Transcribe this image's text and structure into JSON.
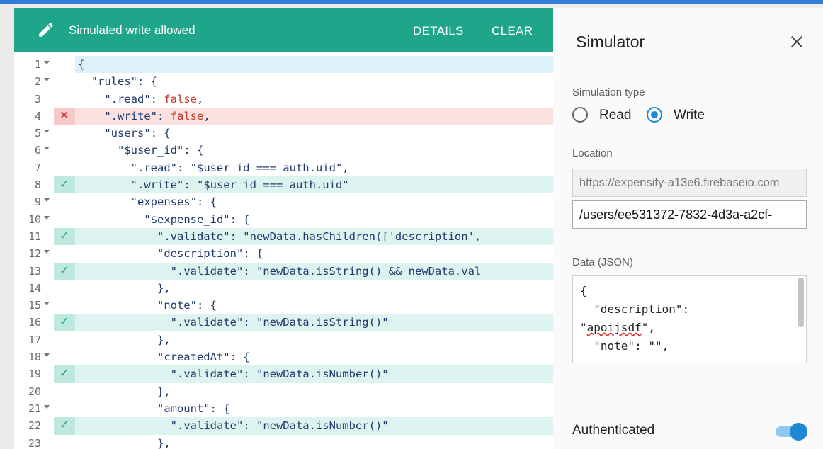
{
  "banner": {
    "message": "Simulated write allowed",
    "details_label": "DETAILS",
    "clear_label": "CLEAR",
    "icon": "pencil-icon"
  },
  "code_lines": [
    {
      "num": "1",
      "fold": true,
      "mark": "",
      "state": "sel",
      "text": "{"
    },
    {
      "num": "2",
      "fold": true,
      "mark": "",
      "state": "",
      "text": "  \"rules\": {"
    },
    {
      "num": "3",
      "fold": false,
      "mark": "",
      "state": "",
      "text": "    \".read\": false,"
    },
    {
      "num": "4",
      "fold": false,
      "mark": "✕",
      "state": "err",
      "text": "    \".write\": false,"
    },
    {
      "num": "5",
      "fold": true,
      "mark": "",
      "state": "",
      "text": "    \"users\": {"
    },
    {
      "num": "6",
      "fold": true,
      "mark": "",
      "state": "",
      "text": "      \"$user_id\": {"
    },
    {
      "num": "7",
      "fold": false,
      "mark": "",
      "state": "",
      "text": "        \".read\": \"$user_id === auth.uid\","
    },
    {
      "num": "8",
      "fold": false,
      "mark": "✓",
      "state": "ok",
      "text": "        \".write\": \"$user_id === auth.uid\""
    },
    {
      "num": "9",
      "fold": true,
      "mark": "",
      "state": "",
      "text": "        \"expenses\": {"
    },
    {
      "num": "10",
      "fold": true,
      "mark": "",
      "state": "",
      "text": "          \"$expense_id\": {"
    },
    {
      "num": "11",
      "fold": false,
      "mark": "✓",
      "state": "ok",
      "text": "            \".validate\": \"newData.hasChildren(['description',"
    },
    {
      "num": "12",
      "fold": true,
      "mark": "",
      "state": "",
      "text": "            \"description\": {"
    },
    {
      "num": "13",
      "fold": false,
      "mark": "✓",
      "state": "ok",
      "text": "              \".validate\": \"newData.isString() && newData.val"
    },
    {
      "num": "14",
      "fold": false,
      "mark": "",
      "state": "",
      "text": "            },"
    },
    {
      "num": "15",
      "fold": true,
      "mark": "",
      "state": "",
      "text": "            \"note\": {"
    },
    {
      "num": "16",
      "fold": false,
      "mark": "✓",
      "state": "ok",
      "text": "              \".validate\": \"newData.isString()\""
    },
    {
      "num": "17",
      "fold": false,
      "mark": "",
      "state": "",
      "text": "            },"
    },
    {
      "num": "18",
      "fold": true,
      "mark": "",
      "state": "",
      "text": "            \"createdAt\": {"
    },
    {
      "num": "19",
      "fold": false,
      "mark": "✓",
      "state": "ok",
      "text": "              \".validate\": \"newData.isNumber()\""
    },
    {
      "num": "20",
      "fold": false,
      "mark": "",
      "state": "",
      "text": "            },"
    },
    {
      "num": "21",
      "fold": true,
      "mark": "",
      "state": "",
      "text": "            \"amount\": {"
    },
    {
      "num": "22",
      "fold": false,
      "mark": "✓",
      "state": "ok",
      "text": "              \".validate\": \"newData.isNumber()\""
    },
    {
      "num": "23",
      "fold": false,
      "mark": "",
      "state": "",
      "text": "            },"
    }
  ],
  "simulator": {
    "title": "Simulator",
    "sim_type_label": "Simulation type",
    "read_label": "Read",
    "write_label": "Write",
    "selected_type": "Write",
    "location_label": "Location",
    "base_url": "https://expensify-a13e6.firebaseio.com",
    "path": "/users/ee531372-7832-4d3a-a2cf-",
    "data_label": "Data (JSON)",
    "json_lines": [
      "{",
      "  \"description\":",
      "\"apoijsdf\",",
      "  \"note\": \"\","
    ],
    "auth_label": "Authenticated",
    "auth_enabled": true
  },
  "colors": {
    "banner": "#1ea58a",
    "accent": "#1e88d6",
    "ok_row": "#dcf3ef",
    "err_row": "#fbe0e0"
  }
}
